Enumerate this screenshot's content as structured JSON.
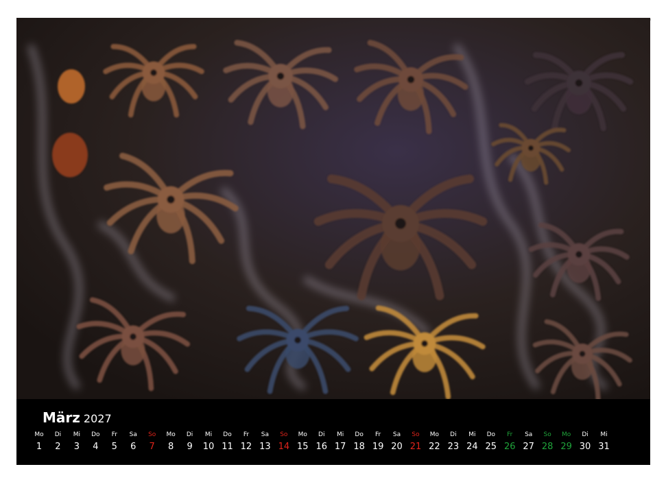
{
  "calendar": {
    "month": "März",
    "year": "2027",
    "days": [
      {
        "wd": "Mo",
        "d": "1",
        "type": "normal"
      },
      {
        "wd": "Di",
        "d": "2",
        "type": "normal"
      },
      {
        "wd": "Mi",
        "d": "3",
        "type": "normal"
      },
      {
        "wd": "Do",
        "d": "4",
        "type": "normal"
      },
      {
        "wd": "Fr",
        "d": "5",
        "type": "normal"
      },
      {
        "wd": "Sa",
        "d": "6",
        "type": "normal"
      },
      {
        "wd": "So",
        "d": "7",
        "type": "sunday"
      },
      {
        "wd": "Mo",
        "d": "8",
        "type": "normal"
      },
      {
        "wd": "Di",
        "d": "9",
        "type": "normal"
      },
      {
        "wd": "Mi",
        "d": "10",
        "type": "normal"
      },
      {
        "wd": "Do",
        "d": "11",
        "type": "normal"
      },
      {
        "wd": "Fr",
        "d": "12",
        "type": "normal"
      },
      {
        "wd": "Sa",
        "d": "13",
        "type": "normal"
      },
      {
        "wd": "So",
        "d": "14",
        "type": "sunday"
      },
      {
        "wd": "Mo",
        "d": "15",
        "type": "normal"
      },
      {
        "wd": "Di",
        "d": "16",
        "type": "normal"
      },
      {
        "wd": "Mi",
        "d": "17",
        "type": "normal"
      },
      {
        "wd": "Do",
        "d": "18",
        "type": "normal"
      },
      {
        "wd": "Fr",
        "d": "19",
        "type": "normal"
      },
      {
        "wd": "Sa",
        "d": "20",
        "type": "normal"
      },
      {
        "wd": "So",
        "d": "21",
        "type": "sunday"
      },
      {
        "wd": "Mo",
        "d": "22",
        "type": "normal"
      },
      {
        "wd": "Di",
        "d": "23",
        "type": "normal"
      },
      {
        "wd": "Mi",
        "d": "24",
        "type": "normal"
      },
      {
        "wd": "Do",
        "d": "25",
        "type": "normal"
      },
      {
        "wd": "Fr",
        "d": "26",
        "type": "holiday"
      },
      {
        "wd": "Sa",
        "d": "27",
        "type": "normal"
      },
      {
        "wd": "So",
        "d": "28",
        "type": "holiday"
      },
      {
        "wd": "Mo",
        "d": "29",
        "type": "holiday"
      },
      {
        "wd": "Di",
        "d": "30",
        "type": "normal"
      },
      {
        "wd": "Mi",
        "d": "31",
        "type": "normal"
      }
    ]
  },
  "colors": {
    "sunday": "#e0241b",
    "holiday": "#1fa33a",
    "text": "#ffffff",
    "strip": "#000000"
  }
}
